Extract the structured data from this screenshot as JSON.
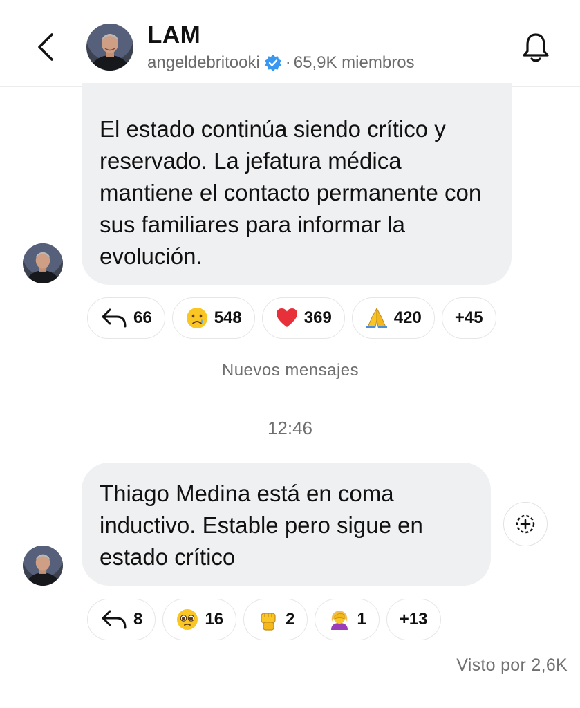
{
  "header": {
    "title": "LAM",
    "handle": "angeldebritooki",
    "separator": "·",
    "members": "65,9K miembros",
    "back_icon": "chevron-left-icon",
    "notification_icon": "bell-icon"
  },
  "messages": [
    {
      "text": "El estado continúa siendo crítico y reservado. La jefatura médica mantiene el contacto permanente con sus familiares para informar la evolución.",
      "reactions": [
        {
          "icon": "reply-icon",
          "count": "66"
        },
        {
          "icon": "crying-face-icon",
          "count": "548"
        },
        {
          "icon": "red-heart-icon",
          "count": "369"
        },
        {
          "icon": "folded-hands-icon",
          "count": "420"
        }
      ],
      "more_reactions": "+45"
    },
    {
      "text": "Thiago Medina está en coma inductivo. Estable pero sigue en estado crítico",
      "reactions": [
        {
          "icon": "reply-icon",
          "count": "8"
        },
        {
          "icon": "pleading-face-icon",
          "count": "16"
        },
        {
          "icon": "raised-fist-icon",
          "count": "2"
        },
        {
          "icon": "woman-facepalming-icon",
          "count": "1"
        }
      ],
      "more_reactions": "+13"
    }
  ],
  "divider": {
    "label": "Nuevos mensajes"
  },
  "time": "12:46",
  "seen_by": "Visto por 2,6K",
  "colors": {
    "bubble": "#eff0f2",
    "verified": "#3897f0",
    "heart": "#e8303a",
    "emoji_yellow": "#f9c623"
  }
}
